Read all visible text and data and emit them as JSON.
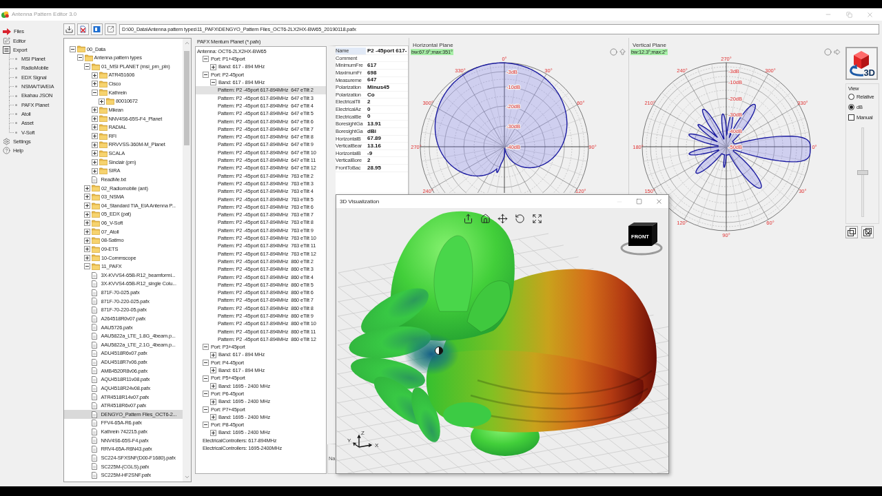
{
  "window": {
    "title": "Antenna Pattern Editor 3.0"
  },
  "nav": {
    "items": [
      {
        "label": "Files"
      },
      {
        "label": "Editor"
      },
      {
        "label": "Export",
        "children": [
          {
            "label": "MSI Planet"
          },
          {
            "label": "RadioMobile"
          },
          {
            "label": "EDX Signal"
          },
          {
            "label": "NSMA/TIA/EIA"
          },
          {
            "label": "Ekahau JSON"
          },
          {
            "label": "PAFX Planet"
          },
          {
            "label": "Atoll"
          },
          {
            "label": "Asset"
          },
          {
            "label": "V-Soft"
          }
        ]
      },
      {
        "label": "Settings"
      },
      {
        "label": "Help"
      }
    ]
  },
  "path_field": {
    "value": "D:\\00_Data\\Antenna pattern types\\11_PAFX\\DENGYO_Pattern Files_OCT6-2LX2HX-BW65_20190118.pafx"
  },
  "file_tree": {
    "items": [
      {
        "label": "00_Data",
        "kind": "folder",
        "expanded": true,
        "selected": false,
        "children": [
          {
            "label": "Antenna pattern types",
            "kind": "folder",
            "expanded": true,
            "selected": false,
            "children": [
              {
                "label": "01_MSI PLANET (msi_prn_pln)",
                "kind": "folder",
                "expanded": true,
                "selected": false,
                "children": [
                  {
                    "label": "ATR451606",
                    "kind": "folder",
                    "expanded": false,
                    "selected": false
                  },
                  {
                    "label": "Cisco",
                    "kind": "folder",
                    "expanded": false,
                    "selected": false
                  },
                  {
                    "label": "Kathrein",
                    "kind": "folder",
                    "expanded": true,
                    "selected": false,
                    "children": [
                      {
                        "label": "80010672",
                        "kind": "folder",
                        "expanded": false,
                        "selected": false
                      }
                    ]
                  },
                  {
                    "label": "Mikran",
                    "kind": "folder",
                    "expanded": false,
                    "selected": false
                  },
                  {
                    "label": "NNV4S6-65S-F4_Planet",
                    "kind": "folder",
                    "expanded": false,
                    "selected": false
                  },
                  {
                    "label": "RADIAL",
                    "kind": "folder",
                    "expanded": false,
                    "selected": false
                  },
                  {
                    "label": "RFI",
                    "kind": "folder",
                    "expanded": false,
                    "selected": false
                  },
                  {
                    "label": "RRVVSS-360M-M_Planet",
                    "kind": "folder",
                    "expanded": false,
                    "selected": false
                  },
                  {
                    "label": "SCALA",
                    "kind": "folder",
                    "expanded": false,
                    "selected": false
                  },
                  {
                    "label": "Sinclair (prn)",
                    "kind": "folder",
                    "expanded": false,
                    "selected": false
                  },
                  {
                    "label": "SIRA",
                    "kind": "folder",
                    "expanded": false,
                    "selected": false
                  },
                  {
                    "label": "ReadMe.txt",
                    "kind": "file",
                    "selected": false
                  }
                ]
              },
              {
                "label": "02_Radiomobile (ant)",
                "kind": "folder",
                "expanded": false,
                "selected": false
              },
              {
                "label": "03_NSMA",
                "kind": "folder",
                "expanded": false,
                "selected": false
              },
              {
                "label": "04_Standard TIA_EIA Antenna P...",
                "kind": "folder",
                "expanded": false,
                "selected": false
              },
              {
                "label": "05_EDX (pat)",
                "kind": "folder",
                "expanded": false,
                "selected": false
              },
              {
                "label": "06_V-Soft",
                "kind": "folder",
                "expanded": false,
                "selected": false
              },
              {
                "label": "07_Atoll",
                "kind": "folder",
                "expanded": false,
                "selected": false
              },
              {
                "label": "08-Satimo",
                "kind": "folder",
                "expanded": false,
                "selected": false
              },
              {
                "label": "09-ETS",
                "kind": "folder",
                "expanded": false,
                "selected": false
              },
              {
                "label": "10-Commscope",
                "kind": "folder",
                "expanded": false,
                "selected": false
              },
              {
                "label": "11_PAFX",
                "kind": "folder",
                "expanded": true,
                "selected": false,
                "children": [
                  {
                    "label": "3X-KVVS4-65B-R12_beamformi...",
                    "kind": "file",
                    "selected": false
                  },
                  {
                    "label": "3X-KVVS4-65B-R12_single Colu...",
                    "kind": "file",
                    "selected": false
                  },
                  {
                    "label": "871F-70-025.pafx",
                    "kind": "file",
                    "selected": false
                  },
                  {
                    "label": "871F-70-220-025.pafx",
                    "kind": "file",
                    "selected": false
                  },
                  {
                    "label": "871F-70-220-05.pafx",
                    "kind": "file",
                    "selected": false
                  },
                  {
                    "label": "A264518R0v07.pafx",
                    "kind": "file",
                    "selected": false
                  },
                  {
                    "label": "AAU5726.pafx",
                    "kind": "file",
                    "selected": false
                  },
                  {
                    "label": "AAU5822a_LTE_1.8G_4beam.p...",
                    "kind": "file",
                    "selected": false
                  },
                  {
                    "label": "AAU5822a_LTE_2.1G_4beam.p...",
                    "kind": "file",
                    "selected": false
                  },
                  {
                    "label": "ADU4518R6v07.pafx",
                    "kind": "file",
                    "selected": false
                  },
                  {
                    "label": "ADU4518R7v06.pafx",
                    "kind": "file",
                    "selected": false
                  },
                  {
                    "label": "AMB4520R8v06.pafx",
                    "kind": "file",
                    "selected": false
                  },
                  {
                    "label": "AQU4518R11v08.pafx",
                    "kind": "file",
                    "selected": false
                  },
                  {
                    "label": "AQU4518R24v08.pafx",
                    "kind": "file",
                    "selected": false
                  },
                  {
                    "label": "ATR4518R14v07.pafx",
                    "kind": "file",
                    "selected": false
                  },
                  {
                    "label": "ATR4518R6v07.pafx",
                    "kind": "file",
                    "selected": false
                  },
                  {
                    "label": "DENGYO_Pattern Files_OCT6-2...",
                    "kind": "file",
                    "selected": true
                  },
                  {
                    "label": "FFV4-65A-R6.pafx",
                    "kind": "file",
                    "selected": false
                  },
                  {
                    "label": "Kathrein 742215.pafx",
                    "kind": "file",
                    "selected": false
                  },
                  {
                    "label": "NNV4S6-65S-F4.pafx",
                    "kind": "file",
                    "selected": false
                  },
                  {
                    "label": "RRV4-65A-R6N43.pafx",
                    "kind": "file",
                    "selected": false
                  },
                  {
                    "label": "SC224-SFXSNF(D00-F1680).pafx",
                    "kind": "file",
                    "selected": false
                  },
                  {
                    "label": "SC225M-(CGLS).pafx",
                    "kind": "file",
                    "selected": false
                  },
                  {
                    "label": "SC225M-HF2SNF.pafx",
                    "kind": "file",
                    "selected": false
                  }
                ]
              }
            ]
          }
        ]
      }
    ]
  },
  "pafx_panel": {
    "title": "PAFX Mentum Planet (*.pafx)",
    "items": [
      {
        "label": "Antenna: OCT6-2LX2HX-BW65",
        "kind": "root",
        "selected": false,
        "children": [
          {
            "label": "Port: P1+45port",
            "kind": "group",
            "expanded": true,
            "selected": false,
            "children": [
              {
                "label": "Band: 617 - 894 MHz",
                "kind": "group",
                "expanded": false,
                "selected": false
              }
            ]
          },
          {
            "label": "Port: P2-45port",
            "kind": "group",
            "expanded": true,
            "selected": false,
            "children": [
              {
                "label": "Band: 617 - 894 MHz",
                "kind": "group",
                "expanded": true,
                "selected": false,
                "children": [
                  {
                    "label": "Pattern: P2 -45port 617-894MHz  647 eTilt 2",
                    "kind": "leaf",
                    "selected": true
                  },
                  {
                    "label": "Pattern: P2 -45port 617-894MHz  647 eTilt 3",
                    "kind": "leaf",
                    "selected": false
                  },
                  {
                    "label": "Pattern: P2 -45port 617-894MHz  647 eTilt 4",
                    "kind": "leaf",
                    "selected": false
                  },
                  {
                    "label": "Pattern: P2 -45port 617-894MHz  647 eTilt 5",
                    "kind": "leaf",
                    "selected": false
                  },
                  {
                    "label": "Pattern: P2 -45port 617-894MHz  647 eTilt 6",
                    "kind": "leaf",
                    "selected": false
                  },
                  {
                    "label": "Pattern: P2 -45port 617-894MHz  647 eTilt 7",
                    "kind": "leaf",
                    "selected": false
                  },
                  {
                    "label": "Pattern: P2 -45port 617-894MHz  647 eTilt 8",
                    "kind": "leaf",
                    "selected": false
                  },
                  {
                    "label": "Pattern: P2 -45port 617-894MHz  647 eTilt 9",
                    "kind": "leaf",
                    "selected": false
                  },
                  {
                    "label": "Pattern: P2 -45port 617-894MHz  647 eTilt 10",
                    "kind": "leaf",
                    "selected": false
                  },
                  {
                    "label": "Pattern: P2 -45port 617-894MHz  647 eTilt 11",
                    "kind": "leaf",
                    "selected": false
                  },
                  {
                    "label": "Pattern: P2 -45port 617-894MHz  647 eTilt 12",
                    "kind": "leaf",
                    "selected": false
                  },
                  {
                    "label": "Pattern: P2 -45port 617-894MHz  763 eTilt 2",
                    "kind": "leaf",
                    "selected": false
                  },
                  {
                    "label": "Pattern: P2 -45port 617-894MHz  763 eTilt 3",
                    "kind": "leaf",
                    "selected": false
                  },
                  {
                    "label": "Pattern: P2 -45port 617-894MHz  763 eTilt 4",
                    "kind": "leaf",
                    "selected": false
                  },
                  {
                    "label": "Pattern: P2 -45port 617-894MHz  763 eTilt 5",
                    "kind": "leaf",
                    "selected": false
                  },
                  {
                    "label": "Pattern: P2 -45port 617-894MHz  763 eTilt 6",
                    "kind": "leaf",
                    "selected": false
                  },
                  {
                    "label": "Pattern: P2 -45port 617-894MHz  763 eTilt 7",
                    "kind": "leaf",
                    "selected": false
                  },
                  {
                    "label": "Pattern: P2 -45port 617-894MHz  763 eTilt 8",
                    "kind": "leaf",
                    "selected": false
                  },
                  {
                    "label": "Pattern: P2 -45port 617-894MHz  763 eTilt 9",
                    "kind": "leaf",
                    "selected": false
                  },
                  {
                    "label": "Pattern: P2 -45port 617-894MHz  763 eTilt 10",
                    "kind": "leaf",
                    "selected": false
                  },
                  {
                    "label": "Pattern: P2 -45port 617-894MHz  763 eTilt 11",
                    "kind": "leaf",
                    "selected": false
                  },
                  {
                    "label": "Pattern: P2 -45port 617-894MHz  763 eTilt 12",
                    "kind": "leaf",
                    "selected": false
                  },
                  {
                    "label": "Pattern: P2 -45port 617-894MHz  860 eTilt 2",
                    "kind": "leaf",
                    "selected": false
                  },
                  {
                    "label": "Pattern: P2 -45port 617-894MHz  860 eTilt 3",
                    "kind": "leaf",
                    "selected": false
                  },
                  {
                    "label": "Pattern: P2 -45port 617-894MHz  860 eTilt 4",
                    "kind": "leaf",
                    "selected": false
                  },
                  {
                    "label": "Pattern: P2 -45port 617-894MHz  860 eTilt 5",
                    "kind": "leaf",
                    "selected": false
                  },
                  {
                    "label": "Pattern: P2 -45port 617-894MHz  860 eTilt 6",
                    "kind": "leaf",
                    "selected": false
                  },
                  {
                    "label": "Pattern: P2 -45port 617-894MHz  860 eTilt 7",
                    "kind": "leaf",
                    "selected": false
                  },
                  {
                    "label": "Pattern: P2 -45port 617-894MHz  860 eTilt 8",
                    "kind": "leaf",
                    "selected": false
                  },
                  {
                    "label": "Pattern: P2 -45port 617-894MHz  860 eTilt 9",
                    "kind": "leaf",
                    "selected": false
                  },
                  {
                    "label": "Pattern: P2 -45port 617-894MHz  860 eTilt 10",
                    "kind": "leaf",
                    "selected": false
                  },
                  {
                    "label": "Pattern: P2 -45port 617-894MHz  860 eTilt 11",
                    "kind": "leaf",
                    "selected": false
                  },
                  {
                    "label": "Pattern: P2 -45port 617-894MHz  860 eTilt 12",
                    "kind": "leaf",
                    "selected": false
                  }
                ]
              }
            ]
          },
          {
            "label": "Port: P3+45port",
            "kind": "group",
            "expanded": true,
            "selected": false,
            "children": [
              {
                "label": "Band: 617 - 894 MHz",
                "kind": "group",
                "expanded": false,
                "selected": false
              }
            ]
          },
          {
            "label": "Port: P4-45port",
            "kind": "group",
            "expanded": true,
            "selected": false,
            "children": [
              {
                "label": "Band: 617 - 894 MHz",
                "kind": "group",
                "expanded": false,
                "selected": false
              }
            ]
          },
          {
            "label": "Port: P5+45port",
            "kind": "group",
            "expanded": true,
            "selected": false,
            "children": [
              {
                "label": "Band: 1695 - 2400 MHz",
                "kind": "group",
                "expanded": false,
                "selected": false
              }
            ]
          },
          {
            "label": "Port: P6-45port",
            "kind": "group",
            "expanded": true,
            "selected": false,
            "children": [
              {
                "label": "Band: 1695 - 2400 MHz",
                "kind": "group",
                "expanded": false,
                "selected": false
              }
            ]
          },
          {
            "label": "Port: P7+45port",
            "kind": "group",
            "expanded": true,
            "selected": false,
            "children": [
              {
                "label": "Band: 1695 - 2400 MHz",
                "kind": "group",
                "expanded": false,
                "selected": false
              }
            ]
          },
          {
            "label": "Port: P8-45port",
            "kind": "group",
            "expanded": true,
            "selected": false,
            "children": [
              {
                "label": "Band: 1695 - 2400 MHz",
                "kind": "group",
                "expanded": false,
                "selected": false
              }
            ]
          },
          {
            "label": "ElectricalControllers: 617-894MHz",
            "kind": "leaf",
            "selected": false
          },
          {
            "label": "ElectricalControllers: 1695-2400MHz",
            "kind": "leaf",
            "selected": false
          }
        ]
      }
    ]
  },
  "properties": {
    "rows": [
      {
        "label": "Name",
        "value": "P2 -45port 617-",
        "selected": true
      },
      {
        "label": "Comment",
        "selected": false
      },
      {
        "label": "MinimumFre",
        "value": "617",
        "selected": false
      },
      {
        "label": "MaximumFr",
        "value": "698",
        "selected": false
      },
      {
        "label": "Measureme",
        "value": "647",
        "selected": false
      },
      {
        "label": "Polarization",
        "value": "Minus45",
        "selected": false
      },
      {
        "label": "Polarization",
        "value": "Co",
        "selected": false
      },
      {
        "label": "ElectricalTil",
        "value": "2",
        "selected": false
      },
      {
        "label": "ElectricalAz",
        "value": "0",
        "selected": false
      },
      {
        "label": "ElectricalBe",
        "value": "0",
        "selected": false
      },
      {
        "label": "BoresightGa",
        "value": "13.91",
        "selected": false
      },
      {
        "label": "BoresightGa",
        "value": "dBi",
        "selected": false
      },
      {
        "label": "HorizontalB",
        "value": "67.89",
        "selected": false
      },
      {
        "label": "VerticalBear",
        "value": "13.16",
        "selected": false
      },
      {
        "label": "HorizontalB",
        "value": "-9",
        "selected": false
      },
      {
        "label": "VerticalBore",
        "value": "2",
        "selected": false
      },
      {
        "label": "FrontToBac",
        "value": "28.95",
        "selected": false
      }
    ],
    "description": "Na"
  },
  "horizontal_plane": {
    "title": "Horizontal Plane",
    "badge": "bw:67.9°;max:351°",
    "angle_labels": [
      "0°",
      "30°",
      "60°",
      "90°",
      "120°",
      "240°",
      "270°",
      "300°",
      "330°"
    ],
    "ring_labels": [
      "-3dB",
      "-10dB",
      "-20dB",
      "-30dB",
      "-40dB"
    ]
  },
  "vertical_plane": {
    "title": "Vertical Plane",
    "badge": "bw:12.3°;max:2°",
    "angle_labels": [
      "270°",
      "300°",
      "330°",
      "0°",
      "30°",
      "60°",
      "90°",
      "120°",
      "150°",
      "180°",
      "210°",
      "240°"
    ],
    "ring_labels": [
      "-3dB",
      "-10dB",
      "-20dB",
      "-30dB",
      "-40dB",
      "-50dB"
    ]
  },
  "right_panel": {
    "view_3d_button": {
      "label": "3D"
    },
    "view_group": {
      "title": "View",
      "options": [
        {
          "label": "Relative",
          "selected": false
        },
        {
          "label": "dB",
          "selected": true
        }
      ],
      "manual": {
        "label": "Manual",
        "checked": false
      },
      "slider": {
        "level": 0.5
      }
    }
  },
  "viz_window": {
    "title": "3D Visualization",
    "view_cube_label": "FRONT",
    "axis_labels": [
      "Z",
      "Y",
      "X"
    ]
  }
}
